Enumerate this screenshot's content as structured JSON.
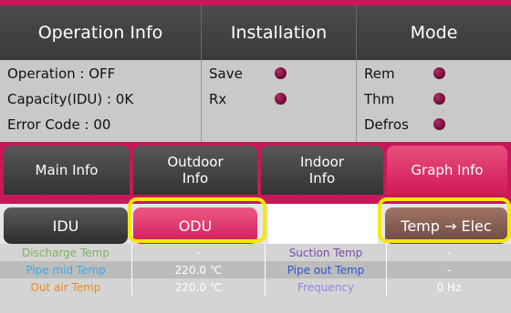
{
  "header": {
    "operation_info": "Operation Info",
    "installation": "Installation",
    "mode": "Mode"
  },
  "operation": {
    "operation": "Operation : OFF",
    "capacity": "Capacity(IDU) : 0K",
    "error_code": "Error Code : 00"
  },
  "installation": {
    "save": "Save",
    "rx": "Rx"
  },
  "mode": {
    "rem": "Rem",
    "thm": "Thm",
    "defros": "Defros"
  },
  "tabs": {
    "main_info": "Main Info",
    "outdoor_info_1": "Outdoor",
    "outdoor_info_2": "Info",
    "indoor_info_1": "Indoor",
    "indoor_info_2": "Info",
    "graph_info": "Graph Info"
  },
  "subtabs": {
    "idu": "IDU",
    "odu": "ODU",
    "temp_elec": "Temp → Elec"
  },
  "table": {
    "rows": [
      {
        "label1": "Discharge Temp",
        "value1": "-",
        "label2": "Suction Temp",
        "value2": "-"
      },
      {
        "label1": "Pipe mid Temp",
        "value1": "220.0 ℃",
        "label2": "Pipe out Temp",
        "value2": "-"
      },
      {
        "label1": "Out air Temp",
        "value1": "220.0 ℃",
        "label2": "Frequency",
        "value2": "0 Hz"
      }
    ]
  },
  "colors": {
    "accent": "#c8185a",
    "active_tab": "#d11a58",
    "highlight": "#f5e800",
    "led": "#7a0a3a"
  }
}
